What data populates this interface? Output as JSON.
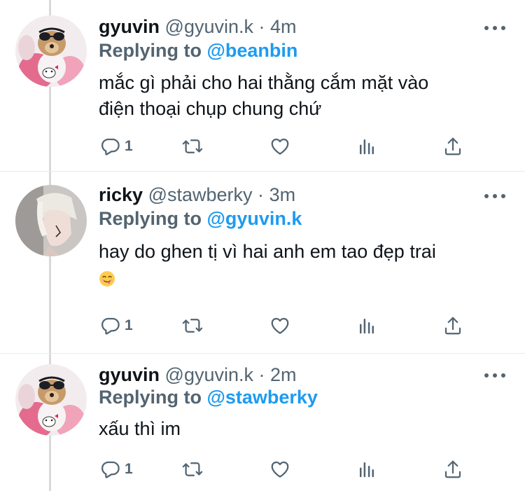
{
  "tweets": [
    {
      "name": "gyuvin",
      "handle": "@gyuvin.k",
      "separator": "·",
      "time": "4m",
      "replying_prefix": "Replying to",
      "replying_to": "@beanbin",
      "text_lines": [
        "mắc gì phải cho hai thằng cắm mặt vào",
        "điện thoại chụp chung chứ"
      ],
      "reply_count": "1",
      "avatar_icon": "dog-avatar"
    },
    {
      "name": "ricky",
      "handle": "@stawberky",
      "separator": "·",
      "time": "3m",
      "replying_prefix": "Replying to",
      "replying_to": "@gyuvin.k",
      "text_lines": [
        "hay do ghen tị vì hai anh em tao đẹp trai"
      ],
      "emoji": "yum-face-emoji",
      "reply_count": "1",
      "avatar_icon": "person-avatar"
    },
    {
      "name": "gyuvin",
      "handle": "@gyuvin.k",
      "separator": "·",
      "time": "2m",
      "replying_prefix": "Replying to",
      "replying_to": "@stawberky",
      "text_lines": [
        "xấu thì im"
      ],
      "reply_count": "1",
      "avatar_icon": "dog-avatar"
    }
  ],
  "colors": {
    "link": "#1d9bf0",
    "secondary_text": "#536471",
    "primary_text": "#0f1419",
    "thread_line": "#d9d9d9"
  },
  "icons": [
    "reply-icon",
    "retweet-icon",
    "like-icon",
    "stats-icon",
    "share-icon",
    "more-icon"
  ]
}
